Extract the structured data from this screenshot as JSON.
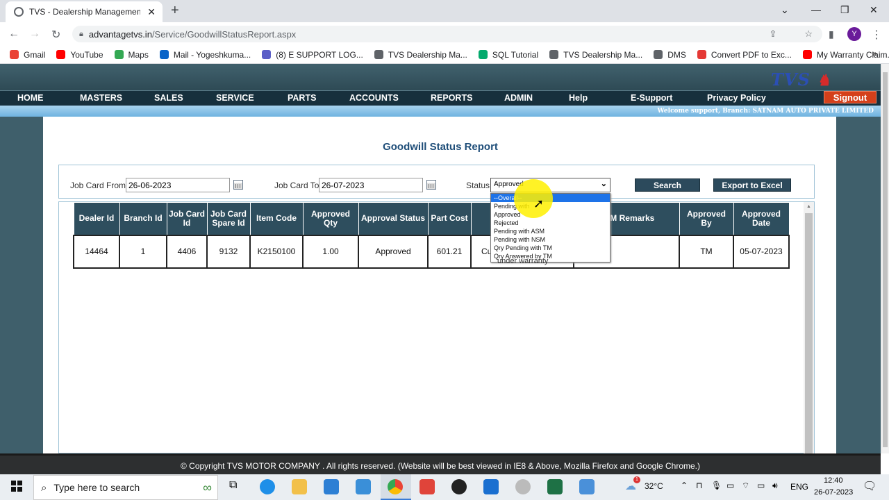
{
  "browser": {
    "tab_title": "TVS - Dealership Management Sy",
    "url_host": "advantagetvs.in",
    "url_path": "/Service/GoodwillStatusReport.aspx",
    "avatar_letter": "Y",
    "bookmarks": [
      {
        "label": "Gmail",
        "icon": "gmail-icon",
        "color": "#ea4335"
      },
      {
        "label": "YouTube",
        "icon": "youtube-icon",
        "color": "#ff0000"
      },
      {
        "label": "Maps",
        "icon": "maps-icon",
        "color": "#34a853"
      },
      {
        "label": "Mail - Yogeshkuma...",
        "icon": "outlook-icon",
        "color": "#0a64c8"
      },
      {
        "label": "(8) E SUPPORT LOG...",
        "icon": "teams-icon",
        "color": "#5b5fc7"
      },
      {
        "label": "TVS Dealership Ma...",
        "icon": "globe-icon",
        "color": "#5f6368"
      },
      {
        "label": "SQL Tutorial",
        "icon": "w3schools-icon",
        "color": "#04aa6d"
      },
      {
        "label": "TVS Dealership Ma...",
        "icon": "globe-icon",
        "color": "#5f6368"
      },
      {
        "label": "DMS",
        "icon": "globe-icon",
        "color": "#5f6368"
      },
      {
        "label": "Convert PDF to Exc...",
        "icon": "heart-icon",
        "color": "#e53935"
      },
      {
        "label": "My Warranty Claim...",
        "icon": "youtube-icon",
        "color": "#ff0000"
      }
    ]
  },
  "site": {
    "logo": "TVS",
    "menu": [
      "HOME",
      "MASTERS",
      "SALES",
      "SERVICE",
      "PARTS",
      "ACCOUNTS",
      "REPORTS",
      "ADMIN",
      "Help",
      "E-Support",
      "Privacy Policy"
    ],
    "signout": "Signout",
    "welcome": "Welcome support, Branch: SATNAM AUTO PRIVATE LIMITED",
    "page_title": "Goodwill Status Report",
    "footer": "© Copyright TVS MOTOR COMPANY . All rights reserved. (Website will be best viewed in IE8 & Above, Mozilla Firefox and Google Chrome.)"
  },
  "filters": {
    "from_label": "Job Card From",
    "from_value": "26-06-2023",
    "to_label": "Job Card To",
    "to_value": "26-07-2023",
    "status_label": "Status",
    "status_value": "Approved",
    "status_options": [
      "--Overall--",
      "Pending with",
      "Approved",
      "Rejected",
      "Pending with ASM",
      "Pending with NSM",
      "Qry Pending with TM",
      "Qry Answered by TM"
    ],
    "search_btn": "Search",
    "export_btn": "Export to Excel"
  },
  "grid": {
    "headers": [
      "Dealer Id",
      "Branch Id",
      "Job Card Id",
      "Job Card Spare Id",
      "Item Code",
      "Approved Qty",
      "Approval Status",
      "Part Cost",
      "",
      "NSM Remarks",
      "Approved By",
      "Approved Date"
    ],
    "row": [
      "14464",
      "1",
      "4406",
      "9132",
      "K2150100",
      "1.00",
      "Approved",
      "601.21",
      "Cu",
      "",
      "TM",
      "05-07-2023"
    ],
    "hidden_partial": "under warranty"
  },
  "taskbar": {
    "search_placeholder": "Type here to search",
    "temp": "32°C",
    "lang": "ENG",
    "time": "12:40",
    "date": "26-07-2023",
    "weather_badge": "1"
  }
}
